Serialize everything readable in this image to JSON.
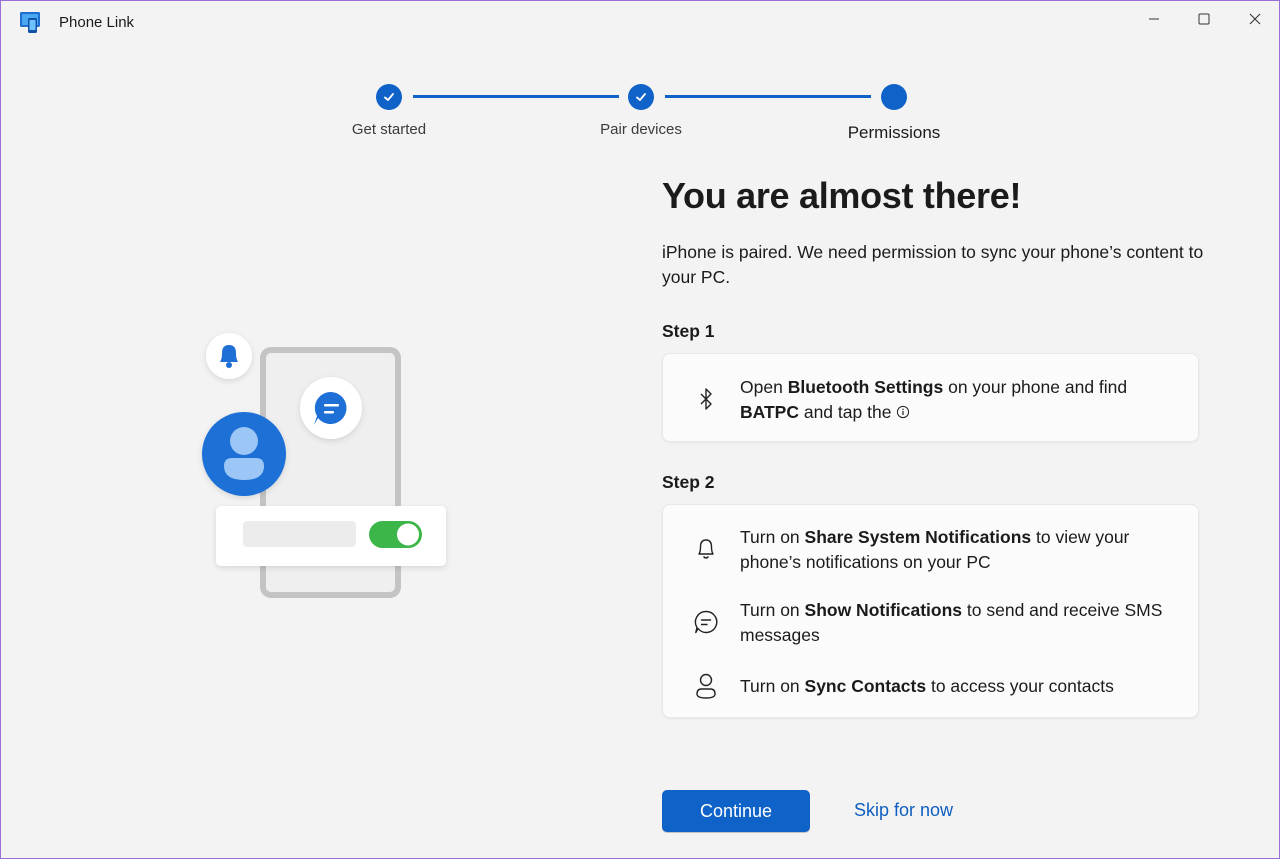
{
  "window": {
    "title": "Phone Link"
  },
  "stepper": {
    "steps": [
      {
        "label": "Get started",
        "state": "done"
      },
      {
        "label": "Pair devices",
        "state": "done"
      },
      {
        "label": "Permissions",
        "state": "current"
      }
    ]
  },
  "main": {
    "heading": "You are almost there!",
    "intro": "iPhone is paired. We need permission to sync your phone’s content to your PC.",
    "step1": {
      "title": "Step 1",
      "items": [
        {
          "icon": "bluetooth-icon",
          "pre": "Open ",
          "bold": "Bluetooth Settings",
          "mid": " on your phone and find ",
          "bold2": "BATPC",
          "post": " and tap the "
        }
      ]
    },
    "step2": {
      "title": "Step 2",
      "items": [
        {
          "icon": "bell-icon",
          "pre": "Turn on ",
          "bold": "Share System Notifications",
          "post": " to view your phone’s notifications on your PC"
        },
        {
          "icon": "chat-icon",
          "pre": "Turn on ",
          "bold": "Show Notifications",
          "post": " to send and receive SMS messages"
        },
        {
          "icon": "person-icon",
          "pre": "Turn on ",
          "bold": "Sync Contacts",
          "post": " to access your contacts"
        }
      ]
    },
    "continue_label": "Continue",
    "skip_label": "Skip for now"
  },
  "colors": {
    "accent": "#0f62c8",
    "toggle_on": "#3cb648",
    "background": "#f3f3f3"
  }
}
